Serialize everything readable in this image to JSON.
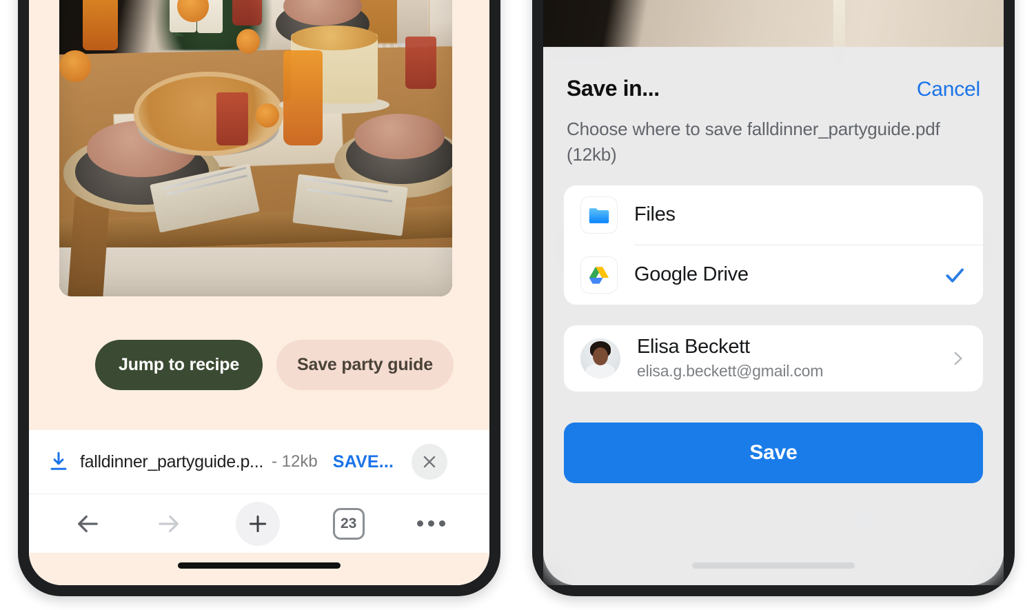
{
  "left_phone": {
    "page": {
      "background_color": "#fdeee1",
      "hero_image_alt": "fall dinner table setting with pumpkin pie and candles"
    },
    "actions": {
      "primary_label": "Jump to recipe",
      "primary_bg": "#3b4a32",
      "secondary_label": "Save party guide",
      "secondary_bg": "#f5dcd0"
    },
    "download_bar": {
      "icon": "download-icon",
      "filename": "falldinner_partyguide.p...",
      "size": "- 12kb",
      "action_label": "SAVE...",
      "action_color": "#1a73e8",
      "close_icon": "close-icon"
    },
    "toolbar": {
      "back_icon": "back-arrow-icon",
      "forward_icon": "forward-arrow-icon",
      "new_tab_icon": "plus-icon",
      "tab_count": "23",
      "more_icon": "more-options-icon"
    }
  },
  "right_phone": {
    "sheet": {
      "title": "Save in...",
      "cancel_label": "Cancel",
      "cancel_color": "#1a73e8",
      "subtitle": "Choose where to save falldinner_partyguide.pdf (12kb)",
      "destinations": [
        {
          "label": "Files",
          "icon": "folder-icon",
          "selected": false
        },
        {
          "label": "Google Drive",
          "icon": "google-drive-icon",
          "selected": true
        }
      ],
      "account": {
        "name": "Elisa Beckett",
        "email": "elisa.g.beckett@gmail.com",
        "avatar": "avatar",
        "chevron": "chevron-right-icon"
      },
      "save_button": {
        "label": "Save",
        "bg": "#1a7ce8",
        "text_color": "#ffffff"
      },
      "check_color": "#2b7de2"
    }
  }
}
